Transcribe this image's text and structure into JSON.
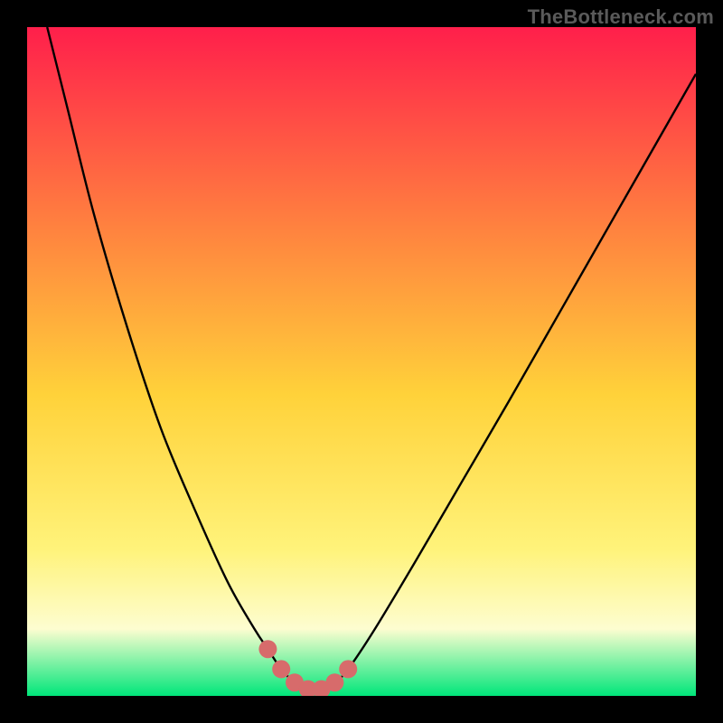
{
  "attribution": "TheBottleneck.com",
  "colors": {
    "bg": "#000000",
    "grad_top": "#ff1f4b",
    "grad_mid_upper": "#ff823f",
    "grad_mid": "#ffd23a",
    "grad_mid_lower": "#fff37a",
    "grad_pale": "#fdfdd0",
    "grad_bottom": "#00e67a",
    "curve": "#000000",
    "marker_fill": "#d76b6b",
    "marker_stroke": "#c75858"
  },
  "chart_data": {
    "type": "line",
    "title": "",
    "xlabel": "",
    "ylabel": "",
    "xlim": [
      0,
      100
    ],
    "ylim": [
      0,
      100
    ],
    "curve": {
      "x": [
        3,
        6,
        10,
        15,
        20,
        25,
        30,
        34,
        36,
        38,
        40,
        42,
        44,
        46,
        48,
        52,
        58,
        65,
        72,
        80,
        88,
        96,
        100
      ],
      "y": [
        100,
        88,
        72,
        55,
        40,
        28,
        17,
        10,
        7,
        4,
        2,
        1,
        1,
        2,
        4,
        10,
        20,
        32,
        44,
        58,
        72,
        86,
        93
      ]
    },
    "markers": {
      "x": [
        36,
        38,
        40,
        42,
        44,
        46,
        48
      ],
      "y": [
        7,
        4,
        2,
        1,
        1,
        2,
        4
      ]
    }
  }
}
